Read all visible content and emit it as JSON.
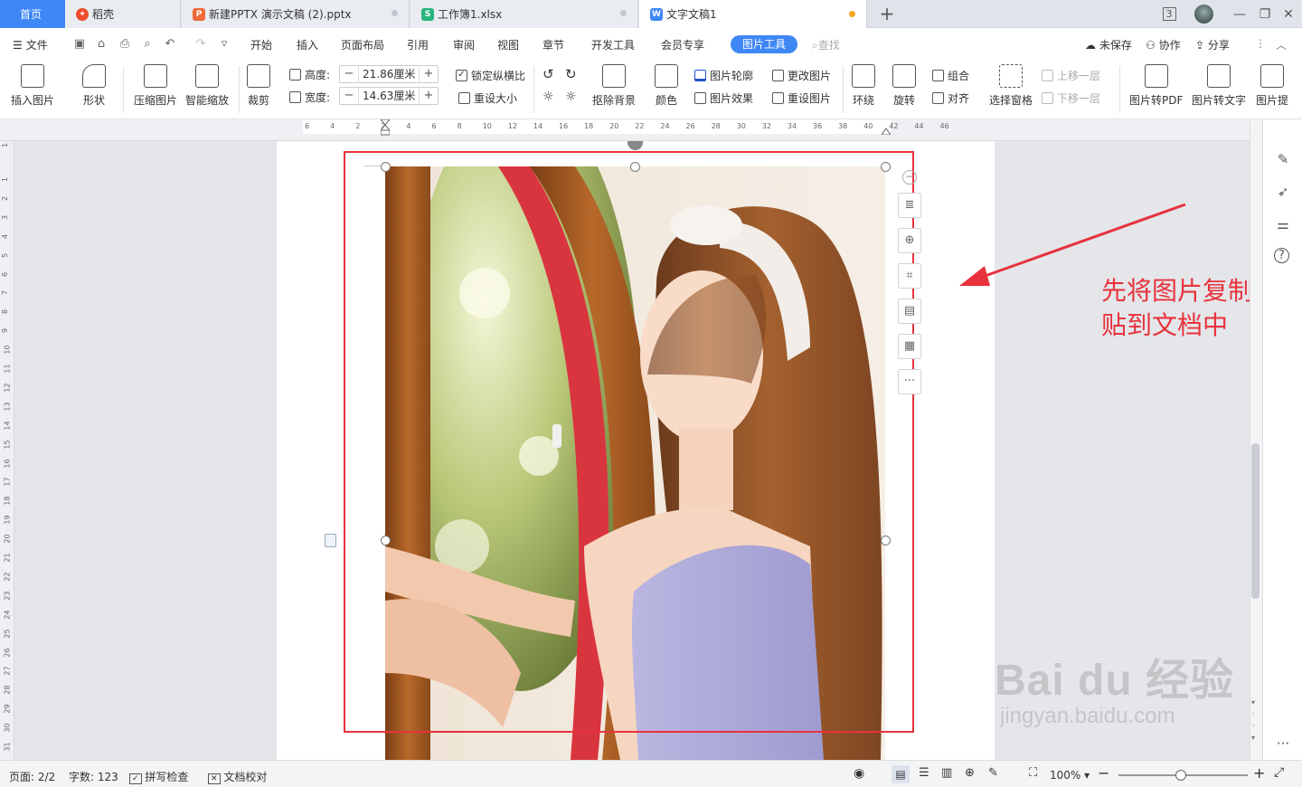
{
  "tabs": [
    {
      "label": "首页",
      "icon": "home-tab"
    },
    {
      "label": "稻壳",
      "icon": "daoke-icon",
      "icon_color": "#ee4d2d"
    },
    {
      "label": "新建PPTX 演示文稿 (2).pptx",
      "icon": "ppt-icon",
      "icon_color": "#ee6a3a"
    },
    {
      "label": "工作簿1.xlsx",
      "icon": "xls-icon",
      "icon_color": "#2ab57d"
    },
    {
      "label": "文字文稿1",
      "icon": "doc-icon",
      "icon_color": "#3f87f5",
      "active": true,
      "unsaved": true
    }
  ],
  "window": {
    "badge": "3"
  },
  "menu": {
    "file": "文件",
    "items": [
      "开始",
      "插入",
      "页面布局",
      "引用",
      "审阅",
      "视图",
      "章节",
      "开发工具",
      "会员专享",
      "图片工具"
    ],
    "active": "图片工具",
    "search": "查找",
    "unsaved": "未保存",
    "collab": "协作",
    "share": "分享"
  },
  "ribbon": {
    "insert_picture": "插入图片",
    "shape": "形状",
    "compress": "压缩图片",
    "smart_scale": "智能缩放",
    "crop": "裁剪",
    "height_label": "高度:",
    "height_value": "21.86厘米",
    "width_label": "宽度:",
    "width_value": "14.63厘米",
    "lock_ratio": "锁定纵横比",
    "reset_size": "重设大小",
    "remove_bg": "抠除背景",
    "color": "颜色",
    "outline": "图片轮廓",
    "effect": "图片效果",
    "change_pic": "更改图片",
    "reset_pic": "重设图片",
    "wrap": "环绕",
    "rotate": "旋转",
    "group": "组合",
    "align": "对齐",
    "selection_pane": "选择窗格",
    "bring_forward": "上移一层",
    "send_backward": "下移一层",
    "to_pdf": "图片转PDF",
    "to_text": "图片转文字",
    "extract": "图片提"
  },
  "ruler": {
    "h_ticks": [
      "6",
      "4",
      "2",
      "2",
      "4",
      "6",
      "8",
      "10",
      "12",
      "14",
      "16",
      "18",
      "20",
      "22",
      "24",
      "26",
      "28",
      "30",
      "32",
      "34",
      "36",
      "38",
      "40",
      "42",
      "44",
      "46"
    ],
    "v_ticks": [
      "1",
      "1",
      "2",
      "3",
      "4",
      "5",
      "6",
      "7",
      "8",
      "9",
      "10",
      "11",
      "12",
      "13",
      "14",
      "15",
      "16",
      "17",
      "18",
      "19",
      "20",
      "21",
      "22",
      "23",
      "24",
      "25",
      "26",
      "27",
      "28",
      "29",
      "30",
      "31"
    ]
  },
  "annotation": {
    "line1": "先将图片复制粘",
    "line2": "贴到文档中",
    "color": "#e8323c"
  },
  "watermark": {
    "logo": "Bai du 经验",
    "url": "jingyan.baidu.com"
  },
  "status": {
    "page": "页面: 2/2",
    "words": "字数: 123",
    "spell": "拼写检查",
    "proof": "文档校对",
    "zoom": "100%"
  }
}
